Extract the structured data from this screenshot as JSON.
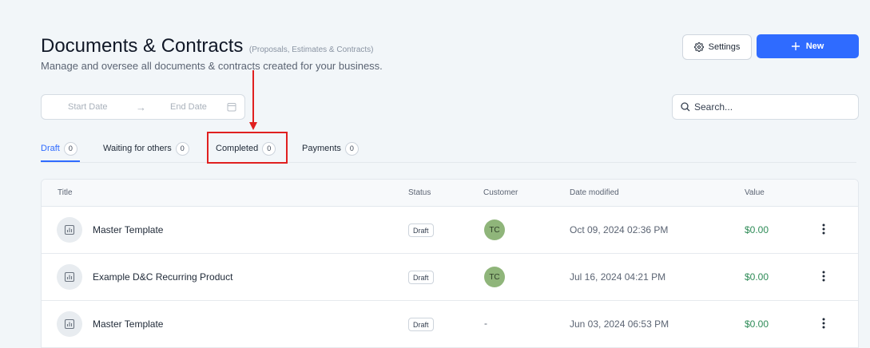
{
  "header": {
    "title": "Documents & Contracts",
    "subtitle": "(Proposals, Estimates & Contracts)",
    "description": "Manage and oversee all documents & contracts created for your business."
  },
  "actions": {
    "settings_label": "Settings",
    "new_label": "New"
  },
  "filters": {
    "start_date_placeholder": "Start Date",
    "end_date_placeholder": "End Date",
    "search_placeholder": "Search..."
  },
  "tabs": [
    {
      "label": "Draft",
      "count": "0"
    },
    {
      "label": "Waiting for others",
      "count": "0"
    },
    {
      "label": "Completed",
      "count": "0"
    },
    {
      "label": "Payments",
      "count": "0"
    }
  ],
  "table": {
    "columns": {
      "title": "Title",
      "status": "Status",
      "customer": "Customer",
      "date_modified": "Date modified",
      "value": "Value"
    },
    "rows": [
      {
        "title": "Master Template",
        "status": "Draft",
        "customer": "TC",
        "date": "Oct 09, 2024 02:36 PM",
        "value": "$0.00"
      },
      {
        "title": "Example D&C Recurring Product",
        "status": "Draft",
        "customer": "TC",
        "date": "Jul 16, 2024 04:21 PM",
        "value": "$0.00"
      },
      {
        "title": "Master Template",
        "status": "Draft",
        "customer": "-",
        "date": "Jun 03, 2024 06:53 PM",
        "value": "$0.00"
      }
    ]
  },
  "colors": {
    "accent": "#2f6bff",
    "value_green": "#2e8b57",
    "avatar_bg": "#8fb57a",
    "annotation_red": "#e02020"
  }
}
